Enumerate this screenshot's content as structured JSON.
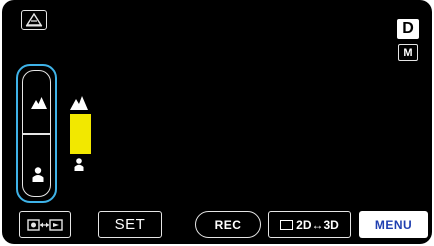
{
  "status": {
    "mode_badge": "D",
    "manual_badge": "M"
  },
  "focus_control": {
    "far_icon": "mountain-icon",
    "near_icon": "person-icon"
  },
  "buttons": {
    "set": "SET",
    "rec": "REC",
    "toggle_2d3d": "2D↔3D",
    "menu": "MENU"
  },
  "colors": {
    "highlight": "#3fb3e8",
    "indicator": "#f2e800",
    "menu_text": "#1f3fb0"
  }
}
